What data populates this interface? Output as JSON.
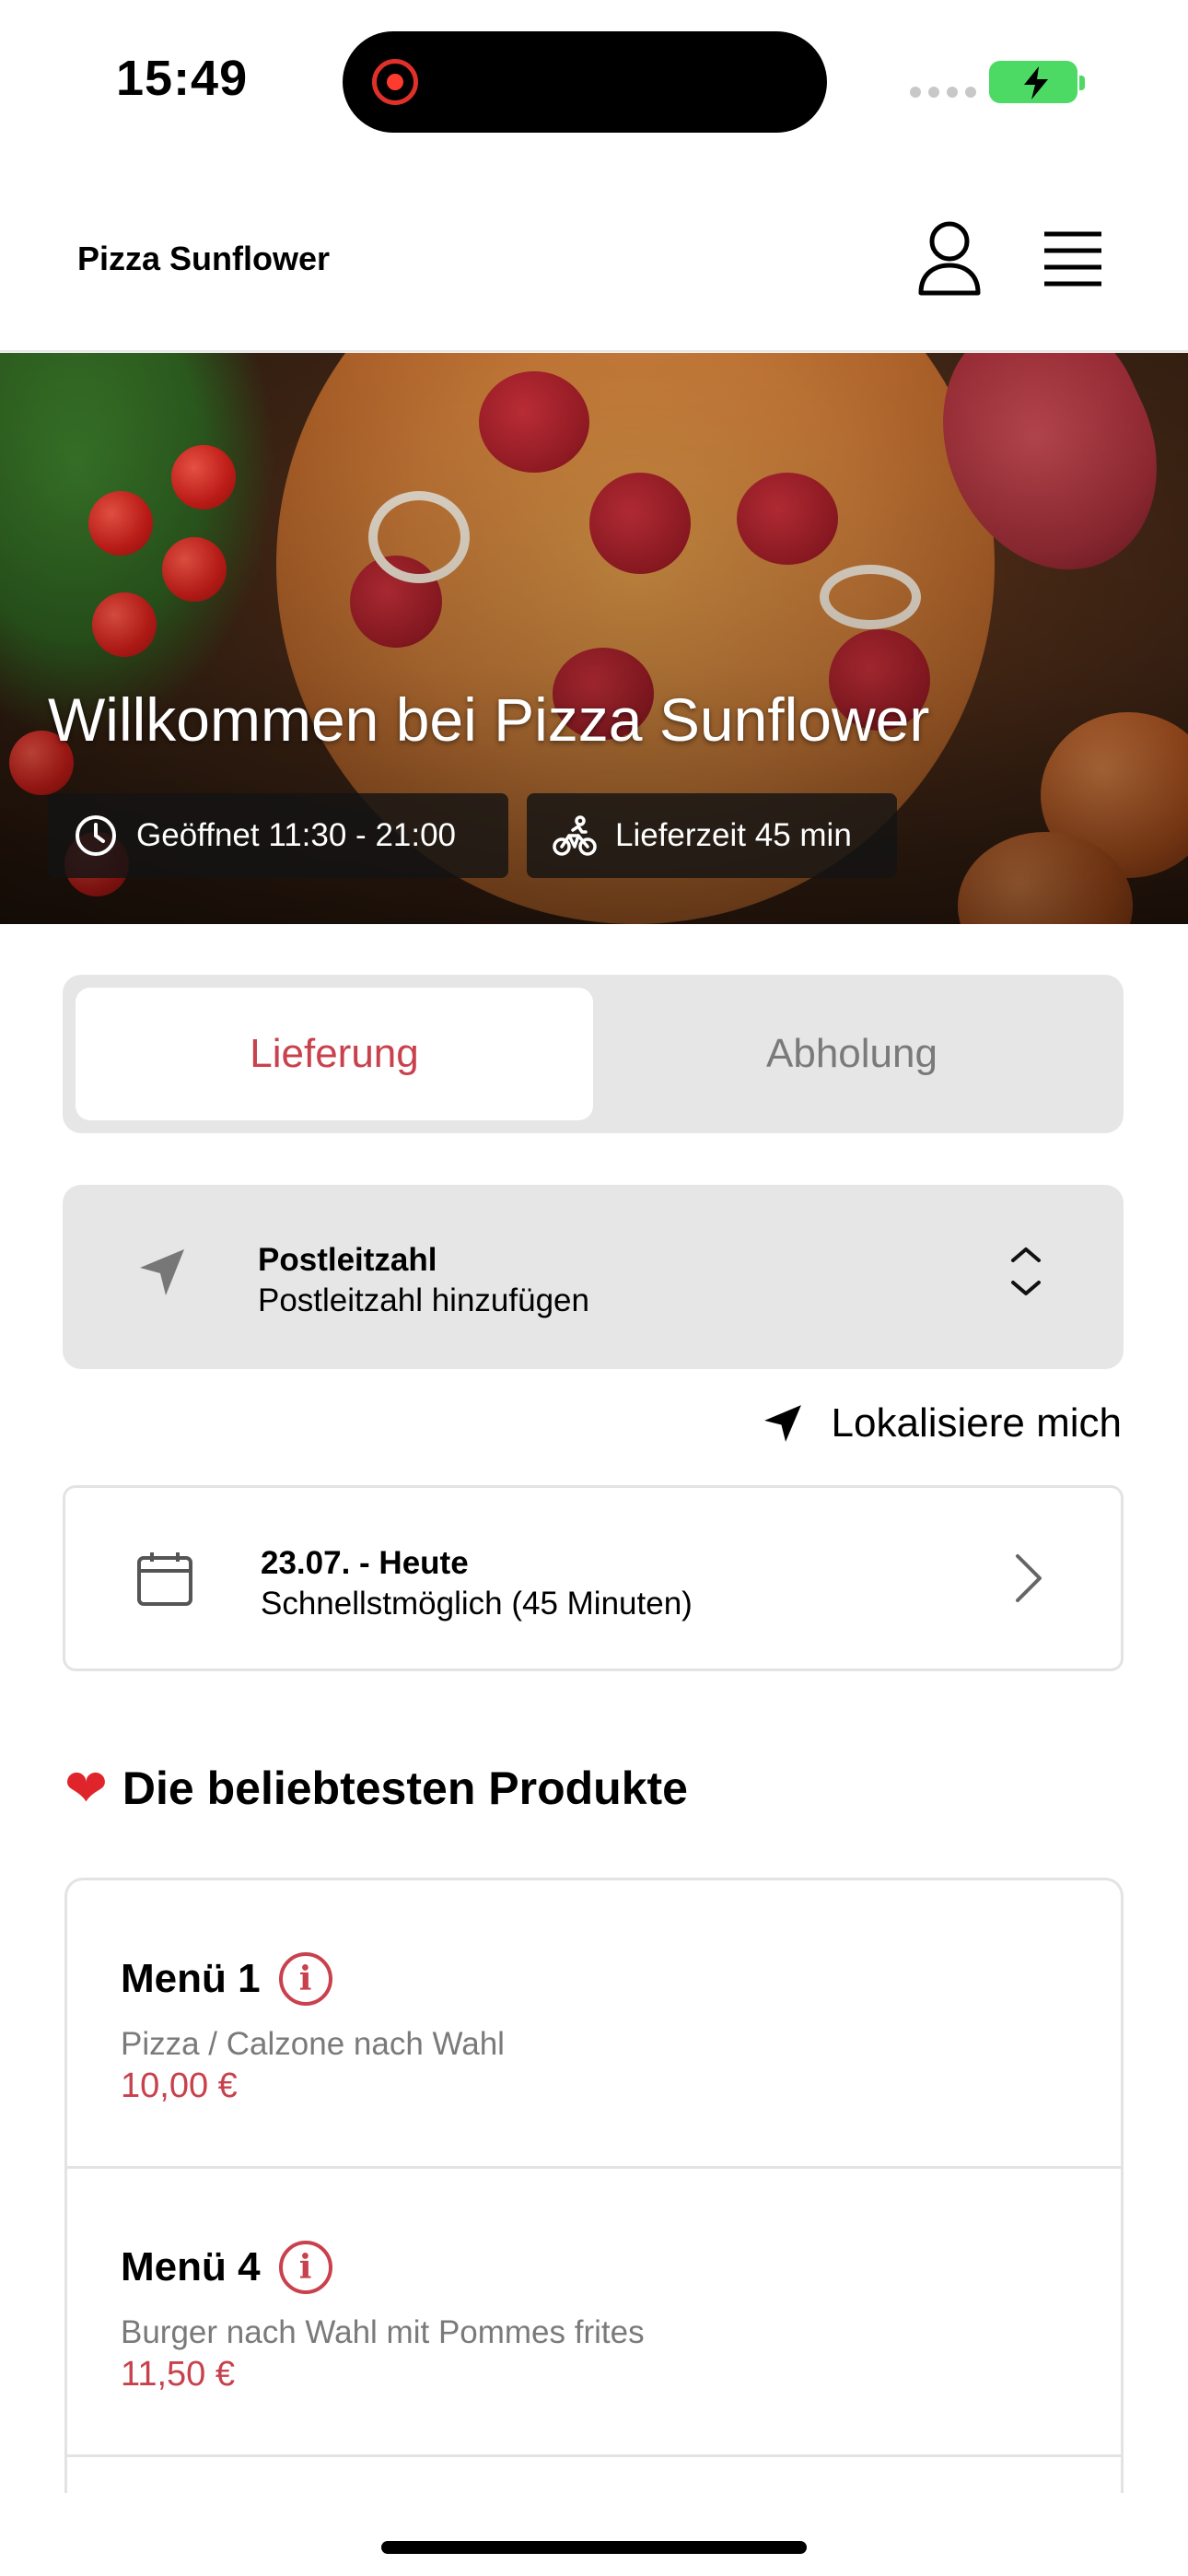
{
  "status_bar": {
    "time": "15:49"
  },
  "header": {
    "brand": "Pizza Sunflower"
  },
  "hero": {
    "title": "Willkommen bei Pizza Sunflower",
    "opening_hours": "Geöffnet 11:30 - 21:00",
    "delivery_time": "Lieferzeit 45 min"
  },
  "order_mode": {
    "options": [
      "Lieferung",
      "Abholung"
    ],
    "selected": "Lieferung"
  },
  "postal_code": {
    "title": "Postleitzahl",
    "placeholder": "Postleitzahl hinzufügen"
  },
  "localize": {
    "label": "Lokalisiere mich"
  },
  "date_picker": {
    "title": "23.07. - Heute",
    "subtitle": "Schnellstmöglich (45 Minuten)"
  },
  "popular": {
    "heading": "Die beliebtesten Produkte",
    "items": [
      {
        "name": "Menü 1",
        "description": "Pizza / Calzone nach Wahl",
        "price": "10,00 €"
      },
      {
        "name": "Menü 4",
        "description": "Burger nach Wahl mit Pommes frites",
        "price": "11,50 €"
      }
    ]
  },
  "colors": {
    "accent": "#c8414c",
    "panel_gray": "#e6e6e6",
    "battery_green": "#4cd964"
  },
  "icons": {
    "user": "user-icon",
    "menu": "hamburger-menu-icon",
    "clock": "clock-icon",
    "bike": "bicycle-icon",
    "location": "location-arrow-icon",
    "chevrons": "chevron-up-down-icon",
    "calendar": "calendar-icon",
    "chevron_right": "chevron-right-icon",
    "heart": "heart-icon",
    "info": "info-icon"
  }
}
